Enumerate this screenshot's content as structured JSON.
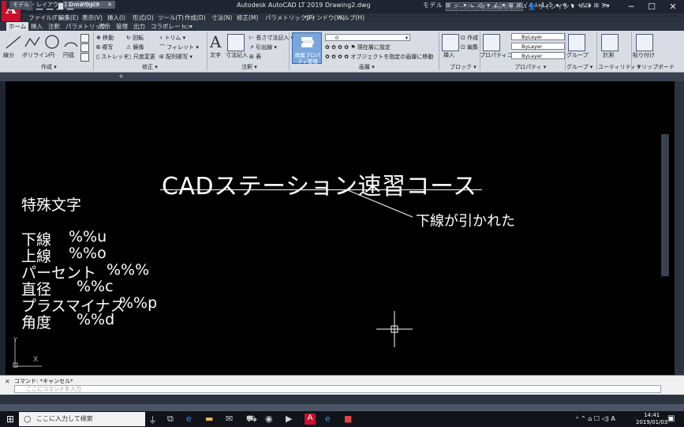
{
  "titlebar": {
    "app_letter": "A",
    "app_sub": "LT",
    "title": "Autodesk AutoCAD LT 2019    Drawing2.dwg",
    "search_placeholder": "キーワードまたは語句を入力",
    "signin": "サインイン",
    "minimize": "─",
    "maximize": "☐",
    "close": "✕"
  },
  "menubar": [
    "ファイル(F)",
    "編集(E)",
    "表示(V)",
    "挿入(I)",
    "形式(O)",
    "ツール(T)",
    "作成(D)",
    "寸法(N)",
    "修正(M)",
    "パラメトリック(P)",
    "ウィンドウ(W)",
    "ヘルプ(H)"
  ],
  "ribbon_tabs": [
    "ホーム",
    "挿入",
    "注釈",
    "パラメトリック",
    "表示",
    "管理",
    "出力",
    "コラボレート"
  ],
  "ribbon": {
    "draw": {
      "label": "作成 ▾",
      "line": "線分",
      "polyline": "ポリライン",
      "circle": "円",
      "arc": "円弧"
    },
    "modify": {
      "label": "修正 ▾",
      "move": "移動",
      "rotate": "回転",
      "trim": "トリム",
      "copy": "複写",
      "mirror": "鏡像",
      "fillet": "フィレット",
      "stretch": "ストレッチ",
      "scale": "尺度変更",
      "array": "配列複写"
    },
    "annotation": {
      "label": "注釈 ▾",
      "text": "文字",
      "dimension": "寸法記入",
      "linear": "長さ寸法記入",
      "leader": "引出線",
      "table": "表"
    },
    "layers": {
      "label": "画層 ▾",
      "layer_props": "画層プロパティ管理",
      "current_layer": "0",
      "set_current": "現在層に設定",
      "match": "オブジェクトを指定の画層に移動"
    },
    "block": {
      "label": "ブロック ▾",
      "insert": "挿入",
      "create": "作成",
      "edit": "編集"
    },
    "properties": {
      "label": "プロパティ ▾",
      "match_props": "プロパティコピー",
      "bylayer1": "ByLayer",
      "bylayer2": "ByLayer",
      "bylayer3": "ByLayer"
    },
    "groups": {
      "label": "グループ ▾",
      "group": "グループ"
    },
    "utilities": {
      "label": "ユーティリティ ▾",
      "measure": "計測"
    },
    "clipboard": {
      "label": "クリップボード",
      "paste": "貼り付け"
    }
  },
  "file_tabs": {
    "start": "スタート",
    "drawing": "Drawing2*",
    "add": "+"
  },
  "canvas": {
    "title": "CADステーション速習コース",
    "annotation": "下線が引かれた",
    "heading": "特殊文字",
    "rows": [
      {
        "label": "下線",
        "code": "%%u"
      },
      {
        "label": "上線",
        "code": "%%o"
      },
      {
        "label": "パーセント",
        "code": "%%%"
      },
      {
        "label": "直径",
        "code": "%%c"
      },
      {
        "label": "プラスマイナス",
        "code": "%%p"
      },
      {
        "label": "角度",
        "code": "%%d"
      }
    ],
    "ucs_x": "X",
    "ucs_y": "Y"
  },
  "command": {
    "history": "コマンド: *キャンセル*",
    "placeholder": "ここにコマンドを入力"
  },
  "status": {
    "model": "モデル",
    "layout1": "レイアウト1",
    "layout2": "レイアウト2",
    "add": "+",
    "right": "モデル ⊞ ⋯ ▾ ⊾ ◎ ▾ ∠ ▾ ⊞ ⊞ ⁄ ⁄ ⅄ 1:1 ▾ ✲ ▾ + ⊡ ⊞ ≡",
    "scale": "1:1"
  },
  "taskbar": {
    "search": "ここに入力して検索",
    "time": "14:41",
    "date": "2019/01/03",
    "ime": "A"
  },
  "colors": {
    "canvas": "#000000",
    "ribbon": "#d9dde3",
    "accent": "#c8102e"
  }
}
